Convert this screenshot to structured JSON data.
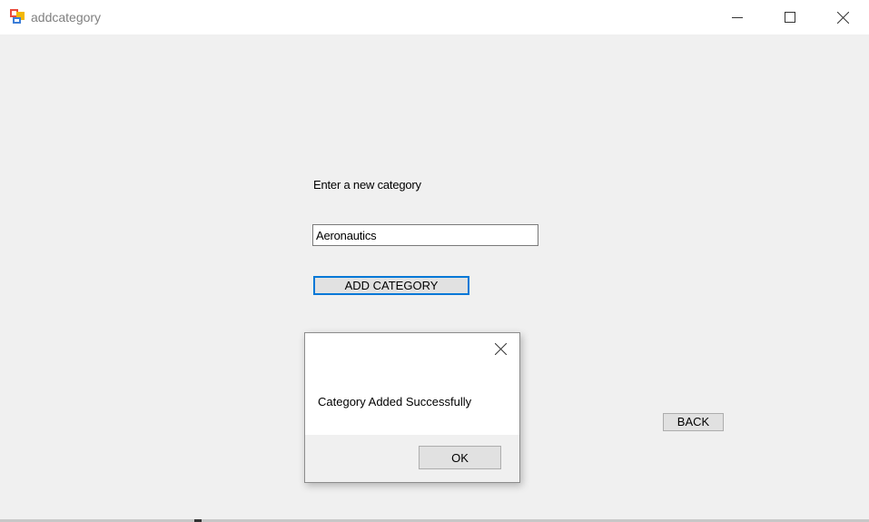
{
  "window": {
    "title": "addcategory",
    "icon": "app-window-icon",
    "controls": {
      "minimize_icon": "minimize-icon",
      "maximize_icon": "maximize-icon",
      "close_icon": "close-icon"
    }
  },
  "form": {
    "prompt_label": "Enter a new category",
    "category_input_value": "Aeronautics",
    "add_button_label": "ADD CATEGORY",
    "back_button_label": "BACK"
  },
  "message_box": {
    "message": "Category Added Successfully",
    "ok_label": "OK",
    "close_icon": "close-icon"
  },
  "colors": {
    "focus_accent": "#0078d7",
    "window_background": "#f0f0f0",
    "title_bar": "#ffffff",
    "button_face": "#e1e1e1"
  }
}
